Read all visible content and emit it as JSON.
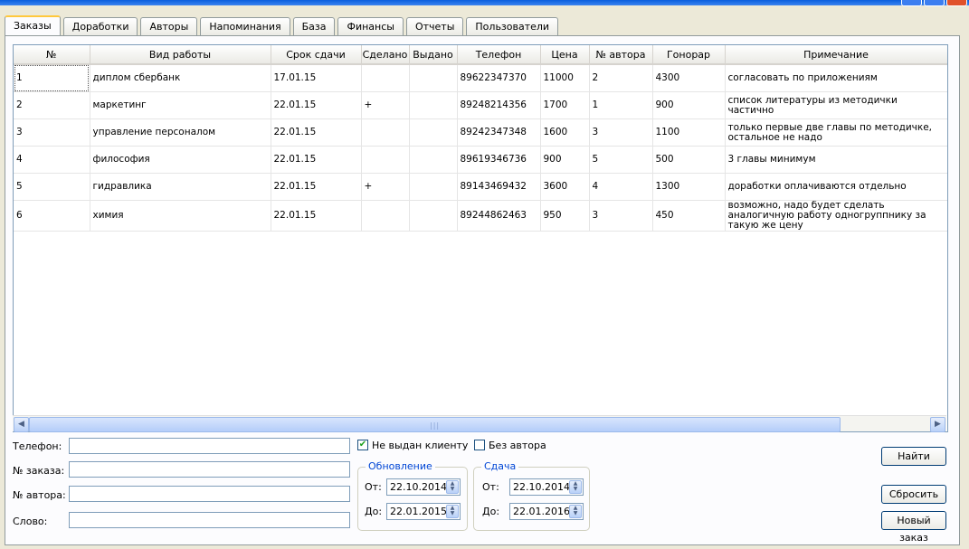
{
  "tabs": [
    "Заказы",
    "Доработки",
    "Авторы",
    "Напоминания",
    "База",
    "Финансы",
    "Отчеты",
    "Пользователи"
  ],
  "table": {
    "columns": [
      "№",
      "Вид работы",
      "Срок сдачи",
      "Сделано",
      "Выдано",
      "Телефон",
      "Цена",
      "№ автора",
      "Гонорар",
      "Примечание"
    ],
    "rows": [
      [
        "1",
        "диплом сбербанк",
        "17.01.15",
        "",
        "",
        "89622347370",
        "11000",
        "2",
        "4300",
        "согласовать по приложениям"
      ],
      [
        "2",
        "маркетинг",
        "22.01.15",
        "+",
        "",
        "89248214356",
        "1700",
        "1",
        "900",
        "список литературы из методички частично"
      ],
      [
        "3",
        "управление персоналом",
        "22.01.15",
        "",
        "",
        "89242347348",
        "1600",
        "3",
        "1100",
        "только первые две главы по методичке, остальное не надо"
      ],
      [
        "4",
        "философия",
        "22.01.15",
        "",
        "",
        "89619346736",
        "900",
        "5",
        "500",
        "3 главы минимум"
      ],
      [
        "5",
        "гидравлика",
        "22.01.15",
        "+",
        "",
        "89143469432",
        "3600",
        "4",
        "1300",
        "доработки оплачиваются отдельно"
      ],
      [
        "6",
        "химия",
        "22.01.15",
        "",
        "",
        "89244862463",
        "950",
        "3",
        "450",
        "возможно, надо будет сделать аналогичную работу одногруппнику за такую же цену"
      ]
    ]
  },
  "filters": {
    "phone_label": "Телефон:",
    "phone_value": "",
    "order_label": "№ заказа:",
    "order_value": "",
    "author_label": "№ автора:",
    "author_value": "",
    "word_label": "Слово:",
    "word_value": "",
    "not_issued_label": "Не выдан клиенту",
    "not_issued_checked": true,
    "no_author_label": "Без автора",
    "no_author_checked": false
  },
  "update_group": {
    "title": "Обновление",
    "from_label": "От:",
    "from_value": "22.10.2014",
    "to_label": "До:",
    "to_value": "22.01.2015"
  },
  "due_group": {
    "title": "Сдача",
    "from_label": "От:",
    "from_value": "22.10.2014",
    "to_label": "До:",
    "to_value": "22.01.2016"
  },
  "buttons": {
    "find": "Найти",
    "reset": "Сбросить",
    "new_order": "Новый заказ"
  },
  "icons": {
    "scroll_left": "arrow-left-icon",
    "scroll_right": "arrow-right-icon",
    "spin": "spin-updown-icon",
    "check": "checkmark-icon"
  }
}
